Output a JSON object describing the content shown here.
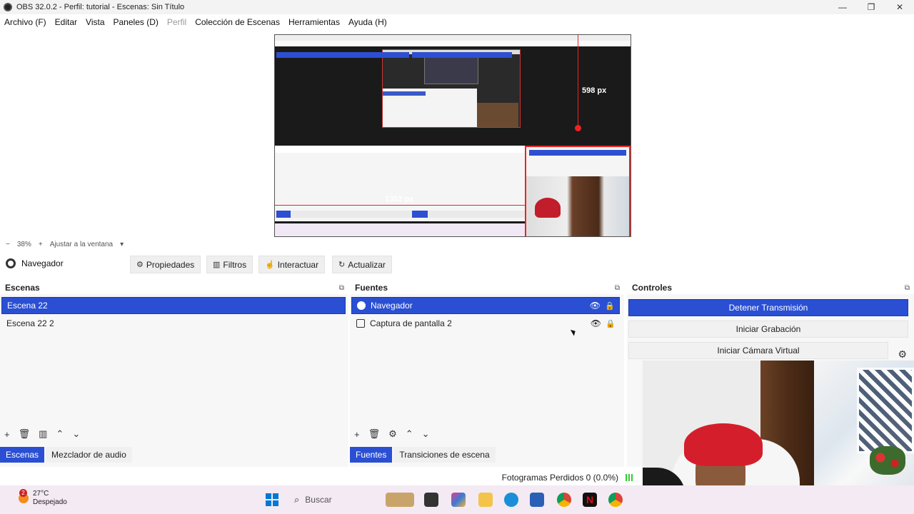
{
  "window": {
    "title": "OBS 32.0.2 - Perfil: tutorial - Escenas: Sin Título",
    "minimize": "—",
    "maximize": "❐",
    "close": "✕"
  },
  "menu": {
    "items": [
      "Archivo (F)",
      "Editar",
      "Vista",
      "Paneles (D)",
      "Perfil",
      "Colección de Escenas",
      "Herramientas",
      "Ayuda (H)"
    ]
  },
  "preview": {
    "height_label": "598 px",
    "width_label": "1352 px"
  },
  "zoom": {
    "minus": "−",
    "value": "38%",
    "plus": "+",
    "fit_label": "Ajustar a la ventana",
    "dropdown": "▾"
  },
  "source_toolbar": {
    "source_name": "Navegador",
    "properties": "Propiedades",
    "filters": "Filtros",
    "interact": "Interactuar",
    "refresh": "Actualizar"
  },
  "scenes": {
    "title": "Escenas",
    "items": [
      "Escena 22",
      "Escena 22 2"
    ],
    "selected": 0
  },
  "sources": {
    "title": "Fuentes",
    "items": [
      "Navegador",
      "Captura de pantalla 2"
    ],
    "selected": 0
  },
  "controls": {
    "title": "Controles",
    "stop_stream": "Detener Transmisión",
    "start_recording": "Iniciar Grabación",
    "start_virtual_cam": "Iniciar Cámara Virtual"
  },
  "tabs": {
    "left": [
      "Escenas",
      "Mezclador de audio"
    ],
    "middle": [
      "Fuentes",
      "Transiciones de escena"
    ]
  },
  "status": {
    "dropped_frames": "Fotogramas Perdidos 0 (0.0%)"
  },
  "taskbar": {
    "temperature": "27°C",
    "weather": "Despejado",
    "notification_count": "2",
    "search_placeholder": "Buscar"
  },
  "colors": {
    "accent": "#2a4fd3",
    "measure_line": "#e22222"
  }
}
